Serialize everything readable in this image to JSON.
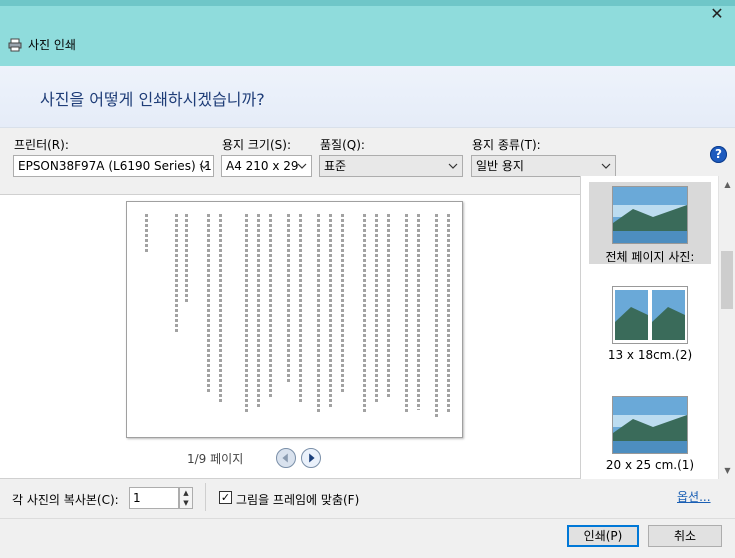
{
  "window": {
    "title": "사진 인쇄",
    "close_glyph": "✕"
  },
  "header": {
    "question": "사진을 어떻게 인쇄하시겠습니까?"
  },
  "controls": {
    "printer": {
      "label": "프린터(R):",
      "value": "EPSON38F97A (L6190 Series) (1"
    },
    "paper_size": {
      "label": "용지 크기(S):",
      "value": "A4 210 x 29"
    },
    "quality": {
      "label": "품질(Q):",
      "value": "표준"
    },
    "paper_type": {
      "label": "용지 종류(T):",
      "value": "일반 용지"
    }
  },
  "preview": {
    "page_indicator": "1/9 페이지"
  },
  "layouts": [
    {
      "label": "전체 페이지 사진:",
      "selected": true
    },
    {
      "label": "13 x 18cm.(2)",
      "selected": false
    },
    {
      "label": "20 x 25 cm.(1)",
      "selected": false
    }
  ],
  "footer": {
    "copies_label": "각 사진의 복사본(C):",
    "copies_value": "1",
    "fit_label": "그림을 프레임에 맞춤(F)",
    "fit_checked": true,
    "options_link": "옵션...",
    "print_button": "인쇄(P)",
    "cancel_button": "취소"
  },
  "colors": {
    "titlebar": "#8fdcdc",
    "header_text": "#1f3d78",
    "link": "#1a5fb4",
    "accent": "#0078d7"
  },
  "icons": [
    "printer-icon",
    "help-icon",
    "close-icon",
    "chevron-down-icon",
    "arrow-left-icon",
    "arrow-right-icon"
  ]
}
